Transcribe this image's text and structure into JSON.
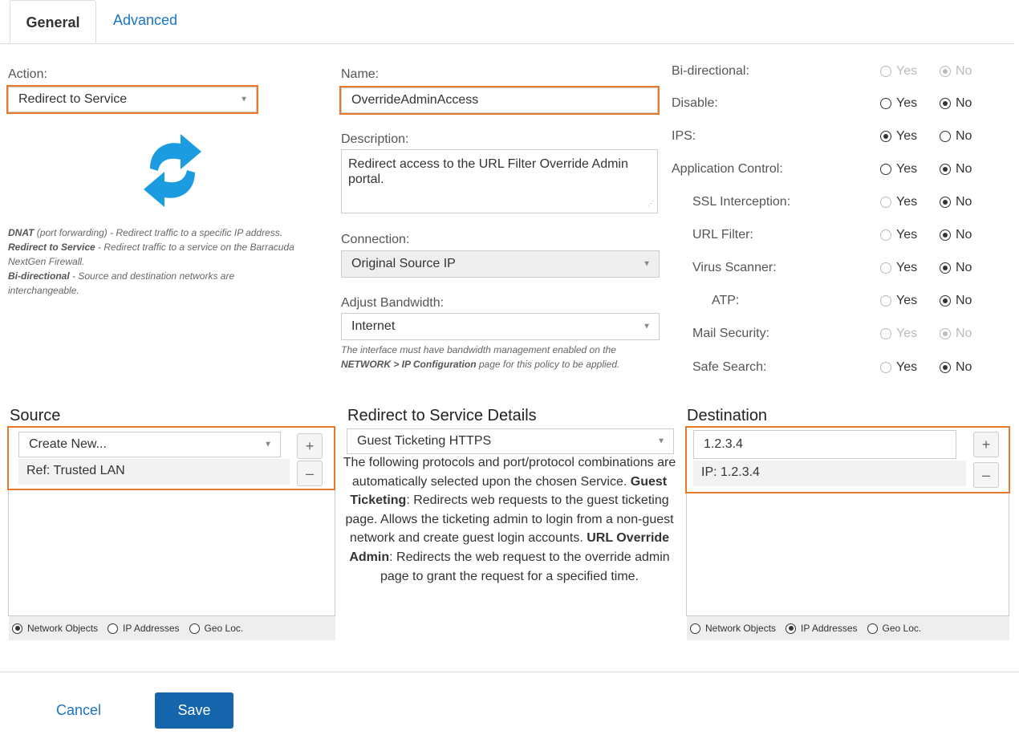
{
  "tabs": {
    "general": "General",
    "advanced": "Advanced"
  },
  "action": {
    "label": "Action:",
    "value": "Redirect to Service"
  },
  "action_note": {
    "dnat_title": "DNAT",
    "dnat_text": " (port forwarding) - Redirect traffic to a specific IP address.",
    "rts_title": "Redirect to Service",
    "rts_text": " - Redirect traffic to a service on the Barracuda NextGen Firewall.",
    "bidi_title": "Bi-directional",
    "bidi_text": " - Source and destination networks are interchangeable."
  },
  "name": {
    "label": "Name:",
    "value": "OverrideAdminAccess"
  },
  "description": {
    "label": "Description:",
    "value": "Redirect access to the URL Filter Override Admin portal."
  },
  "connection": {
    "label": "Connection:",
    "value": "Original Source IP"
  },
  "bandwidth": {
    "label": "Adjust Bandwidth:",
    "value": "Internet",
    "note_a": "The interface must have bandwidth management enabled on the ",
    "note_b": "NETWORK > IP Configuration",
    "note_c": " page for this policy to be applied."
  },
  "options": {
    "yes": "Yes",
    "no": "No",
    "rows": [
      {
        "label": "Bi-directional:",
        "value": "No"
      },
      {
        "label": "Disable:",
        "value": "No"
      },
      {
        "label": "IPS:",
        "value": "Yes"
      },
      {
        "label": "Application Control:",
        "value": "No"
      },
      {
        "label": "SSL Interception:",
        "value": "No"
      },
      {
        "label": "URL Filter:",
        "value": "No"
      },
      {
        "label": "Virus Scanner:",
        "value": "No"
      },
      {
        "label": "ATP:",
        "value": "No"
      },
      {
        "label": "Mail Security:",
        "value": "No"
      },
      {
        "label": "Safe Search:",
        "value": "No"
      }
    ]
  },
  "source": {
    "title": "Source",
    "select": "Create New...",
    "entry": "Ref: Trusted LAN",
    "modes": [
      "Network Objects",
      "IP Addresses",
      "Geo Loc."
    ],
    "selected_mode": "Network Objects"
  },
  "redirect": {
    "title": "Redirect to Service Details",
    "service": "Guest Ticketing HTTPS",
    "p1": "The following protocols and port/protocol combinations are automatically selected upon the chosen Service. ",
    "b1": "Guest Ticketing",
    "p2": ": Redirects web requests to the guest ticketing page. Allows the ticketing admin to login from a non-guest network and create guest login accounts. ",
    "b2": "URL Override Admin",
    "p3": ": Redirects the web request to the override admin page to grant the request for a specified time."
  },
  "destination": {
    "title": "Destination",
    "input": "1.2.3.4",
    "entry": "IP: 1.2.3.4",
    "modes": [
      "Network Objects",
      "IP Addresses",
      "Geo Loc."
    ],
    "selected_mode": "IP Addresses"
  },
  "footer": {
    "cancel": "Cancel",
    "save": "Save"
  },
  "icons": {
    "add": "+",
    "remove": "–",
    "caret": "▼"
  }
}
